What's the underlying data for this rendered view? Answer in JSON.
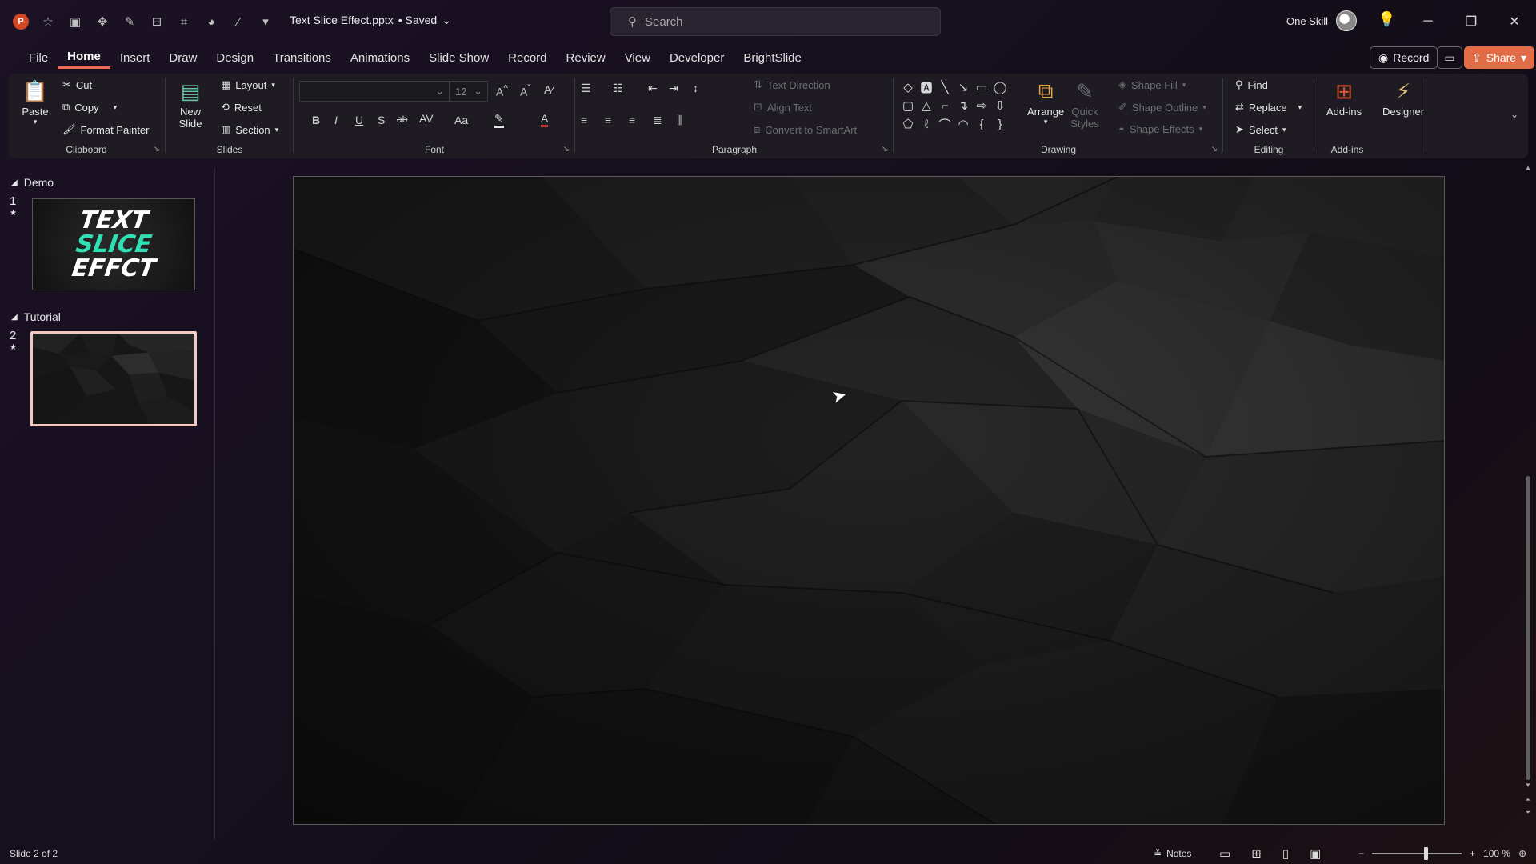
{
  "app": {
    "doc_name": "Text Slice Effect.pptx",
    "save_state": "• Saved",
    "search_placeholder": "Search",
    "user_name": "One Skill"
  },
  "tabs": [
    "File",
    "Home",
    "Insert",
    "Draw",
    "Design",
    "Transitions",
    "Animations",
    "Slide Show",
    "Record",
    "Review",
    "View",
    "Developer",
    "BrightSlide"
  ],
  "active_tab": "Home",
  "top_right": {
    "record_label": "Record",
    "share_label": "Share"
  },
  "ribbon": {
    "clipboard": {
      "label": "Clipboard",
      "paste": "Paste",
      "cut": "Cut",
      "copy": "Copy",
      "format_painter": "Format Painter"
    },
    "slides": {
      "label": "Slides",
      "new_slide_line1": "New",
      "new_slide_line2": "Slide",
      "layout": "Layout",
      "reset": "Reset",
      "section": "Section"
    },
    "font": {
      "label": "Font",
      "font_name": "",
      "font_size": "12",
      "bold": "B",
      "italic": "I",
      "underline": "U",
      "shadow": "S",
      "strike": "ab",
      "spacing": "AV",
      "case": "Aa",
      "color": "A"
    },
    "paragraph": {
      "label": "Paragraph",
      "text_direction": "Text Direction",
      "align_text": "Align Text",
      "smartart": "Convert to SmartArt"
    },
    "drawing": {
      "label": "Drawing",
      "arrange": "Arrange",
      "quick_styles_line1": "Quick",
      "quick_styles_line2": "Styles",
      "shape_fill": "Shape Fill",
      "shape_outline": "Shape Outline",
      "shape_effects": "Shape Effects"
    },
    "editing": {
      "label": "Editing",
      "find": "Find",
      "replace": "Replace",
      "select": "Select"
    },
    "addins": {
      "label": "Add-ins",
      "addins_btn": "Add-ins",
      "designer": "Designer"
    }
  },
  "slides_pane": {
    "sections": [
      {
        "name": "Demo",
        "slides": [
          {
            "number": "1",
            "thumb_lines": [
              "TEXT",
              "SLICE",
              "EFFCT"
            ]
          }
        ]
      },
      {
        "name": "Tutorial",
        "slides": [
          {
            "number": "2"
          }
        ]
      }
    ]
  },
  "status": {
    "slide_info": "Slide 2 of 2",
    "notes": "Notes",
    "zoom": "100 %",
    "zoom_fraction": 0.6
  },
  "colors": {
    "accent": "#e86b52",
    "share_bg": "#e06c48",
    "thumb_slice": "#2fe0b5",
    "selected_thumb_border": "#f3c8c0"
  }
}
